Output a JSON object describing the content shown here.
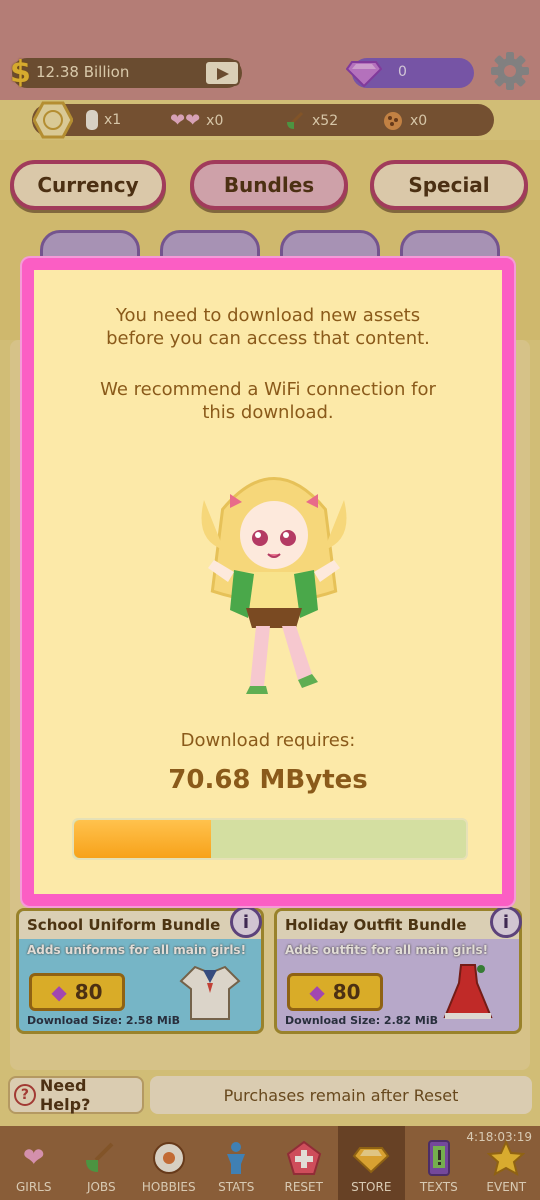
{
  "topbar": {
    "money_symbol": "$",
    "money": "12.38 Billion",
    "gems": "0"
  },
  "inventory": {
    "items": [
      {
        "icon": "scroll-icon",
        "count": "x1"
      },
      {
        "icon": "hearts-icon",
        "count": "x0"
      },
      {
        "icon": "shovel-icon",
        "count": "x52"
      },
      {
        "icon": "cookie-icon",
        "count": "x0"
      }
    ]
  },
  "tabs": [
    {
      "label": "Currency"
    },
    {
      "label": "Bundles"
    },
    {
      "label": "Special"
    }
  ],
  "modal": {
    "line1": "You need to download new assets",
    "line2": "before you can access that content.",
    "line3": "We recommend a WiFi connection for",
    "line4": "this download.",
    "requires_label": "Download requires:",
    "size": "70.68 MBytes",
    "progress": 0.35
  },
  "bundles": [
    {
      "title": "School Uniform Bundle",
      "desc": "Adds uniforms for all main girls!",
      "price": "80",
      "download": "Download Size: 2.58 MiB"
    },
    {
      "title": "Holiday Outfit Bundle",
      "desc": "Adds outfits for all main girls!",
      "price": "80",
      "download": "Download Size: 2.82 MiB"
    }
  ],
  "info_glyph": "i",
  "help": {
    "glyph": "?",
    "label": "Need Help?"
  },
  "purchases_note": "Purchases remain after Reset",
  "nav": {
    "items": [
      {
        "label": "GIRLS"
      },
      {
        "label": "JOBS"
      },
      {
        "label": "HOBBIES"
      },
      {
        "label": "STATS"
      },
      {
        "label": "RESET"
      },
      {
        "label": "STORE"
      },
      {
        "label": "TEXTS"
      },
      {
        "label": "EVENT"
      }
    ],
    "clock": "4:18:03:19"
  },
  "colors": {
    "modal_border": "#fb5ec4",
    "modal_bg": "#fce9a8",
    "progress_fill": "#f7a21a",
    "progress_track": "#d4dfa1"
  }
}
